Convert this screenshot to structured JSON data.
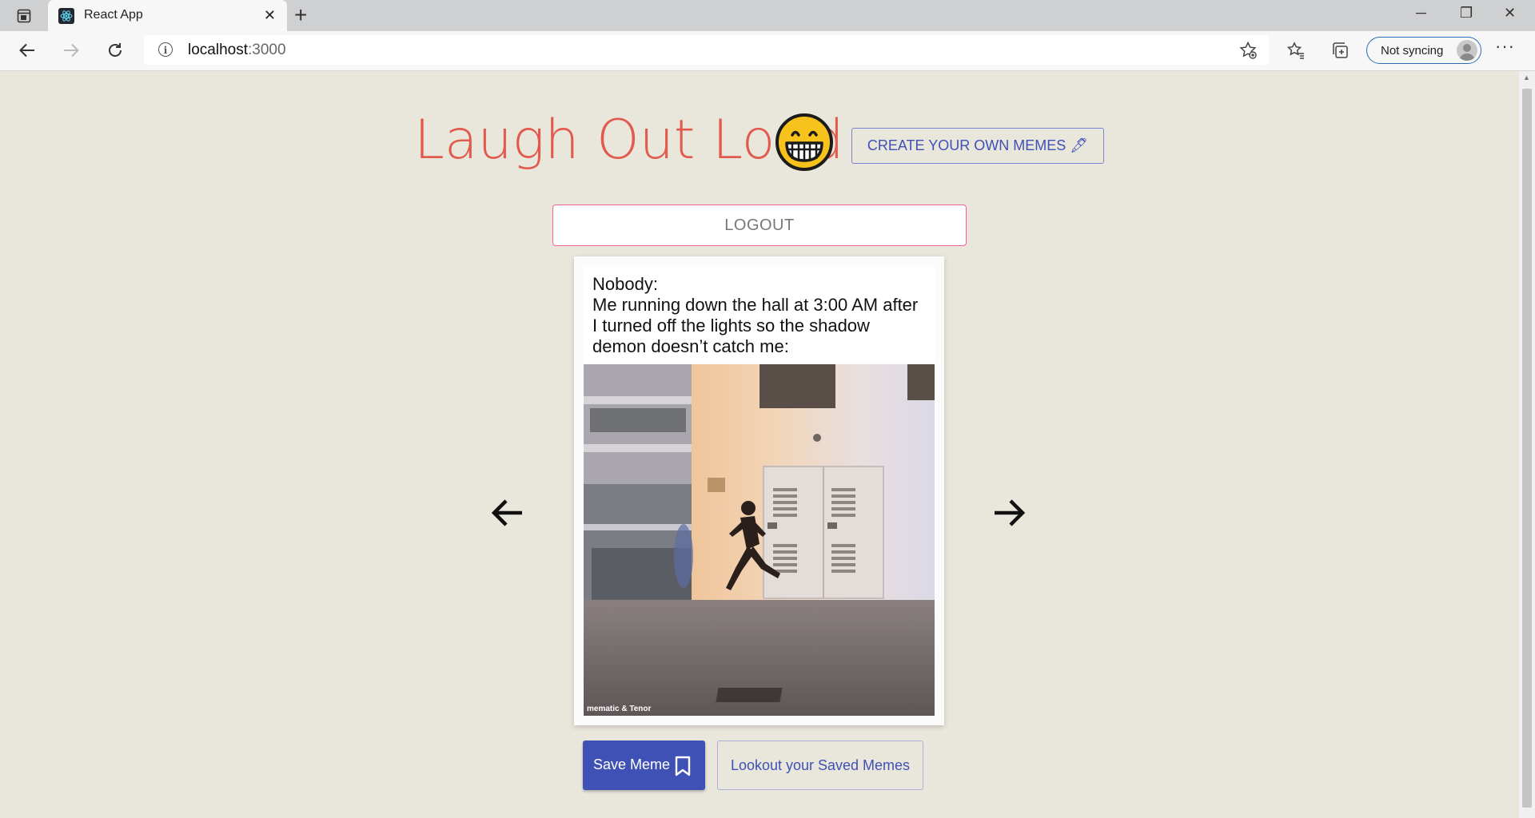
{
  "browser": {
    "tab_title": "React App",
    "url_host": "localhost",
    "url_port": ":3000",
    "sync_label": "Not syncing",
    "menu_label": "···"
  },
  "header": {
    "title": "Laugh Out Loud",
    "emoji_icon": "grinning-face-icon",
    "create_button": "CREATE YOUR OWN MEMES 🖋"
  },
  "logout_button": "LOGOUT",
  "meme": {
    "caption_line1": "Nobody:",
    "caption_line2": "Me running down the hall at 3:00 AM after I turned off the lights so the shadow demon doesn’t catch me:",
    "watermark": "mematic & Tenor"
  },
  "navigation": {
    "prev_icon": "arrow-left-icon",
    "next_icon": "arrow-right-icon"
  },
  "actions": {
    "save_button": "Save Meme",
    "saved_button": "Lookout your Saved Memes"
  },
  "colors": {
    "background": "#e9e6dc",
    "title": "#e25a4d",
    "primary": "#3f51b5",
    "logout_border": "#f06292"
  }
}
